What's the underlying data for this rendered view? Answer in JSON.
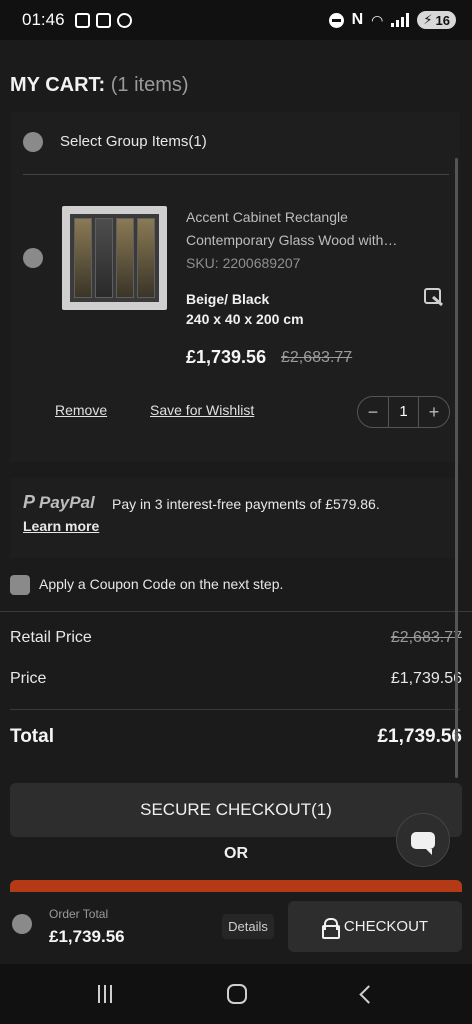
{
  "status_bar": {
    "time": "01:46",
    "battery": "16",
    "nfc_label": "N"
  },
  "cart": {
    "title": "MY CART:",
    "count_label": "(1 items)",
    "group_label": "Select Group Items(1)",
    "item": {
      "name": "Accent Cabinet Rectangle Contemporary Glass Wood with…",
      "sku": "SKU: 2200689207",
      "color": "Beige/ Black",
      "dimensions": "240 x 40 x 200 cm",
      "price": "£1,739.56",
      "old_price": "£2,683.77",
      "remove_label": "Remove",
      "wishlist_label": "Save for Wishlist",
      "quantity": "1",
      "minus": "−",
      "plus": "+"
    }
  },
  "paypal": {
    "mark": "P",
    "brand": "PayPal",
    "message": "Pay in 3 interest-free payments of £579.86.",
    "learn_more": "Learn more"
  },
  "coupon": {
    "label": "Apply a Coupon Code on the next step."
  },
  "summary": {
    "retail_label": "Retail Price",
    "retail_value": "£2,683.77",
    "price_label": "Price",
    "price_value": "£1,739.56",
    "total_label": "Total",
    "total_value": "£1,739.56"
  },
  "actions": {
    "secure_checkout": "SECURE CHECKOUT(1)",
    "or": "OR"
  },
  "bottom_bar": {
    "order_total_label": "Order Total",
    "order_total_value": "£1,739.56",
    "details": "Details",
    "checkout": "CHECKOUT"
  },
  "colors": {
    "background": "#1b1b1b",
    "accent_orange": "#b33a14",
    "button": "#2d2d2d"
  }
}
